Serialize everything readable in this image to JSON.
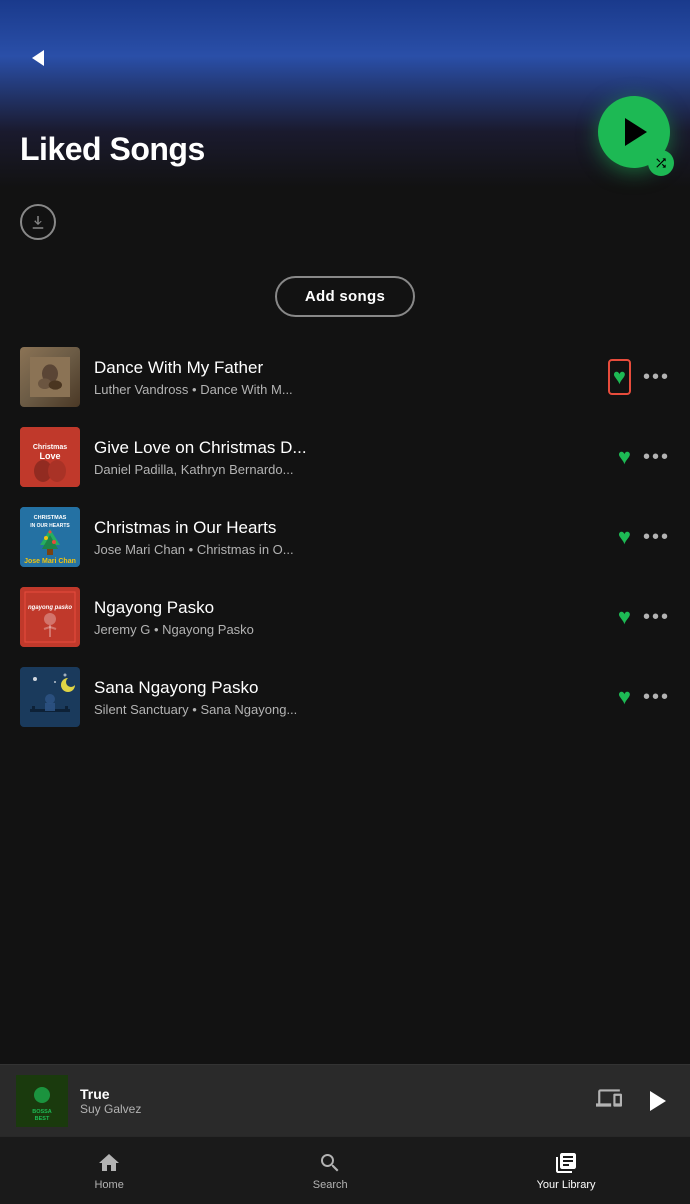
{
  "header": {
    "back_label": "Back",
    "title": "Liked Songs"
  },
  "controls": {
    "download_label": "Download",
    "add_songs_label": "Add songs"
  },
  "songs": [
    {
      "id": 1,
      "title": "Dance With My Father",
      "meta": "Luther Vandross • Dance With M...",
      "liked": true,
      "highlighted": true,
      "art_style": "dance"
    },
    {
      "id": 2,
      "title": "Give Love on Christmas D...",
      "meta": "Daniel Padilla, Kathryn Bernardo...",
      "liked": true,
      "highlighted": false,
      "art_style": "christmas-love"
    },
    {
      "id": 3,
      "title": "Christmas in Our Hearts",
      "meta": "Jose Mari Chan • Christmas in O...",
      "liked": true,
      "highlighted": false,
      "art_style": "christmas-hearts"
    },
    {
      "id": 4,
      "title": "Ngayong Pasko",
      "meta": "Jeremy G • Ngayong Pasko",
      "liked": true,
      "highlighted": false,
      "art_style": "ngayong"
    },
    {
      "id": 5,
      "title": "Sana Ngayong Pasko",
      "meta": "Silent Sanctuary • Sana Ngayong...",
      "liked": true,
      "highlighted": false,
      "art_style": "sana"
    }
  ],
  "now_playing": {
    "title": "True",
    "artist": "Suy Galvez",
    "art_label": "BOSSA BEST"
  },
  "bottom_nav": {
    "items": [
      {
        "id": "home",
        "label": "Home",
        "active": false
      },
      {
        "id": "search",
        "label": "Search",
        "active": false
      },
      {
        "id": "library",
        "label": "Your Library",
        "active": true
      }
    ]
  },
  "colors": {
    "green": "#1DB954",
    "highlight_red": "#e74c3c",
    "text_secondary": "#b3b3b3",
    "bg_dark": "#121212"
  }
}
